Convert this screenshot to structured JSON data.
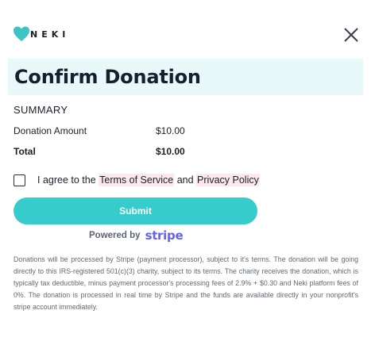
{
  "header": {
    "logo_text": "NEKI",
    "brand_color": "#3cc3c2"
  },
  "dialog": {
    "title": "Confirm Donation"
  },
  "summary": {
    "heading": "SUMMARY",
    "rows": [
      {
        "label": "Donation Amount",
        "value": "$10.00"
      },
      {
        "label": "Total",
        "value": "$10.00"
      }
    ]
  },
  "agreement": {
    "prefix": "I agree to the ",
    "terms_link": "Terms of Service",
    "conjunction": " and ",
    "privacy_link": "Privacy Policy",
    "checked": false
  },
  "actions": {
    "submit_label": "Submit",
    "submit_color": "#35cccb"
  },
  "powered_by": {
    "label": "Powered by",
    "brand": "stripe",
    "brand_color": "#6461f6"
  },
  "disclaimer": "Donations will be processed by Stripe (payment processor), subject to it's terms. The donation will be going directly to this IRS-registered 501(c)(3) charity, subject to its terms. The charity receives the donation, which is typically tax deductible, minus payment processor's processing fees of 2.9% + $0.30 and Neki platform fees of 0%. The donation is processed in real time by Stripe and the funds are available directly in your nonprofit's stripe account immediately."
}
